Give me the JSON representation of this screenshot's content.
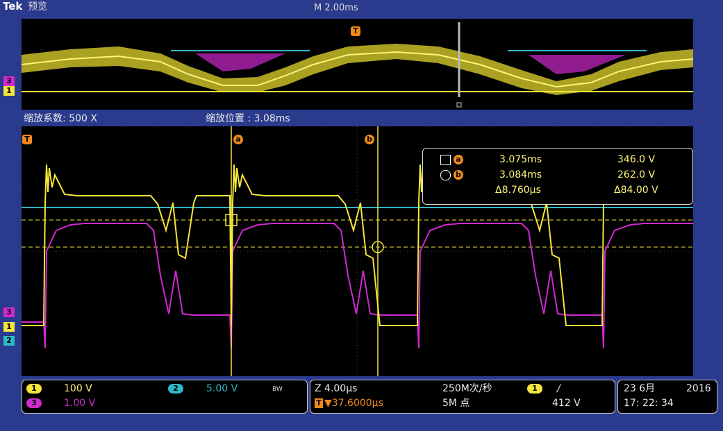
{
  "header": {
    "brand": "Tek",
    "mode": "预览",
    "timebase": "M 2.00ms"
  },
  "zoom": {
    "factor_label": "缩放系数: 500 X",
    "position_label": "缩放位置 : 3.08ms"
  },
  "markers": {
    "trigger": "T",
    "cursor_a": "a",
    "cursor_b": "b",
    "ch1": "1",
    "ch2": "2",
    "ch3": "3"
  },
  "readout": {
    "a_time": "3.075ms",
    "a_volt": "346.0 V",
    "b_time": "3.084ms",
    "b_volt": "262.0 V",
    "delta_time": "Δ8.760µs",
    "delta_volt": "Δ84.00 V"
  },
  "channels": {
    "ch1": {
      "label": "1",
      "scale": "100 V",
      "color": "#f5e63a"
    },
    "ch2": {
      "label": "2",
      "scale": "5.00 V",
      "bw": "BW",
      "color": "#2fb8c8"
    },
    "ch3": {
      "label": "3",
      "scale": "1.00 V",
      "color": "#d02ad0"
    }
  },
  "horizontal": {
    "scale": "Z 4.00µs",
    "position": "▼37.6000µs",
    "sample_rate": "250M次/秒",
    "record_length": "5M 点"
  },
  "trigger": {
    "source": "1",
    "slope": "/",
    "level": "412 V"
  },
  "clock": {
    "date": "23 6月",
    "year": "2016",
    "time": "17: 22: 34"
  }
}
